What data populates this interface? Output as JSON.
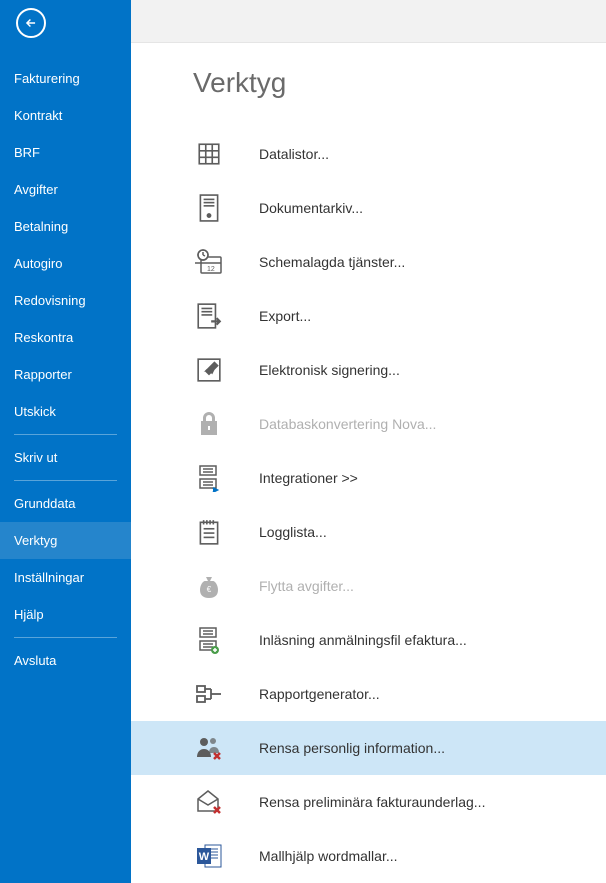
{
  "sidebar": {
    "items": [
      {
        "label": "Fakturering",
        "key": "fakturering"
      },
      {
        "label": "Kontrakt",
        "key": "kontrakt"
      },
      {
        "label": "BRF",
        "key": "brf"
      },
      {
        "label": "Avgifter",
        "key": "avgifter"
      },
      {
        "label": "Betalning",
        "key": "betalning"
      },
      {
        "label": "Autogiro",
        "key": "autogiro"
      },
      {
        "label": "Redovisning",
        "key": "redovisning"
      },
      {
        "label": "Reskontra",
        "key": "reskontra"
      },
      {
        "label": "Rapporter",
        "key": "rapporter"
      },
      {
        "label": "Utskick",
        "key": "utskick"
      }
    ],
    "secondary": [
      {
        "label": "Skriv ut",
        "key": "skriv-ut"
      }
    ],
    "tertiary": [
      {
        "label": "Grunddata",
        "key": "grunddata"
      },
      {
        "label": "Verktyg",
        "key": "verktyg",
        "selected": true
      },
      {
        "label": "Inställningar",
        "key": "installningar"
      },
      {
        "label": "Hjälp",
        "key": "hjalp"
      }
    ],
    "footer": [
      {
        "label": "Avsluta",
        "key": "avsluta"
      }
    ]
  },
  "page": {
    "title": "Verktyg"
  },
  "tools": [
    {
      "label": "Datalistor...",
      "icon": "grid",
      "key": "datalistor"
    },
    {
      "label": "Dokumentarkiv...",
      "icon": "server",
      "key": "dokumentarkiv"
    },
    {
      "label": "Schemalagda tjänster...",
      "icon": "calendar-clock",
      "key": "schemalagda"
    },
    {
      "label": "Export...",
      "icon": "export",
      "key": "export"
    },
    {
      "label": "Elektronisk signering...",
      "icon": "sign",
      "key": "signering"
    },
    {
      "label": "Databaskonvertering Nova...",
      "icon": "lock",
      "key": "databaskonvertering",
      "disabled": true
    },
    {
      "label": "Integrationer >>",
      "icon": "integration",
      "key": "integrationer"
    },
    {
      "label": "Logglista...",
      "icon": "log",
      "key": "logglista"
    },
    {
      "label": "Flytta avgifter...",
      "icon": "money-bag",
      "key": "flytta-avgifter",
      "disabled": true
    },
    {
      "label": "Inläsning anmälningsfil efaktura...",
      "icon": "server-plus",
      "key": "inlasning"
    },
    {
      "label": "Rapportgenerator...",
      "icon": "report",
      "key": "rapportgenerator"
    },
    {
      "label": "Rensa personlig information...",
      "icon": "users-remove",
      "key": "rensa-personlig",
      "highlighted": true
    },
    {
      "label": "Rensa preliminära fakturaunderlag...",
      "icon": "envelope-remove",
      "key": "rensa-preliminara"
    },
    {
      "label": "Mallhjälp wordmallar...",
      "icon": "word",
      "key": "mallhjalp"
    }
  ]
}
